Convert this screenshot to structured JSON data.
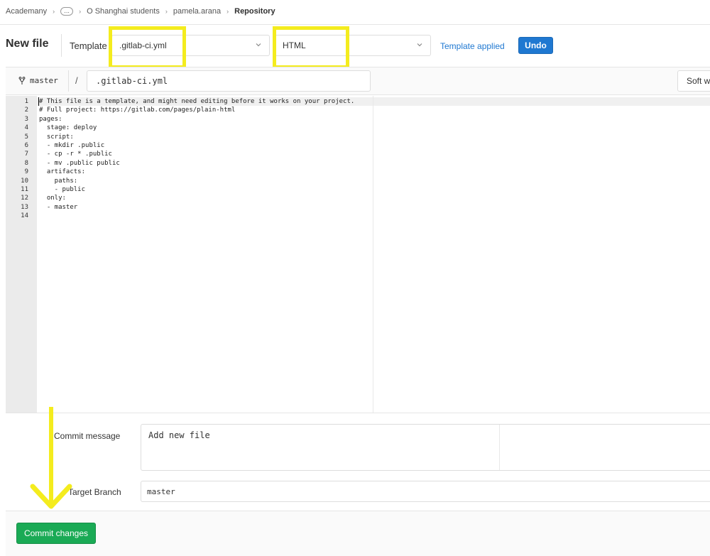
{
  "breadcrumb": {
    "items": [
      "Academany",
      "…",
      "O Shanghai students",
      "pamela.arana",
      "Repository"
    ]
  },
  "header": {
    "title": "New file",
    "template_label": "Template",
    "template_value": ".gitlab-ci.yml",
    "type_value": "HTML",
    "template_status": "Template applied",
    "undo_label": "Undo"
  },
  "file_bar": {
    "branch": "master",
    "separator": "/",
    "filename": ".gitlab-ci.yml",
    "soft_wrap_label": "Soft wrap"
  },
  "editor": {
    "line_numbers": [
      "1",
      "2",
      "3",
      "4",
      "5",
      "6",
      "7",
      "8",
      "9",
      "10",
      "11",
      "12",
      "13",
      "14"
    ],
    "lines": [
      "# This file is a template, and might need editing before it works on your project.",
      "# Full project: https://gitlab.com/pages/plain-html",
      "pages:",
      "  stage: deploy",
      "  script:",
      "  - mkdir .public",
      "  - cp -r * .public",
      "  - mv .public public",
      "  artifacts:",
      "    paths:",
      "    - public",
      "  only:",
      "  - master",
      ""
    ]
  },
  "commit": {
    "message_label": "Commit message",
    "message_value": "Add new file",
    "branch_label": "Target Branch",
    "branch_value": "master",
    "submit_label": "Commit changes"
  },
  "colors": {
    "highlight": "#f4ec1e",
    "primary_blue": "#1f78d1",
    "success_green": "#1aaa55"
  }
}
